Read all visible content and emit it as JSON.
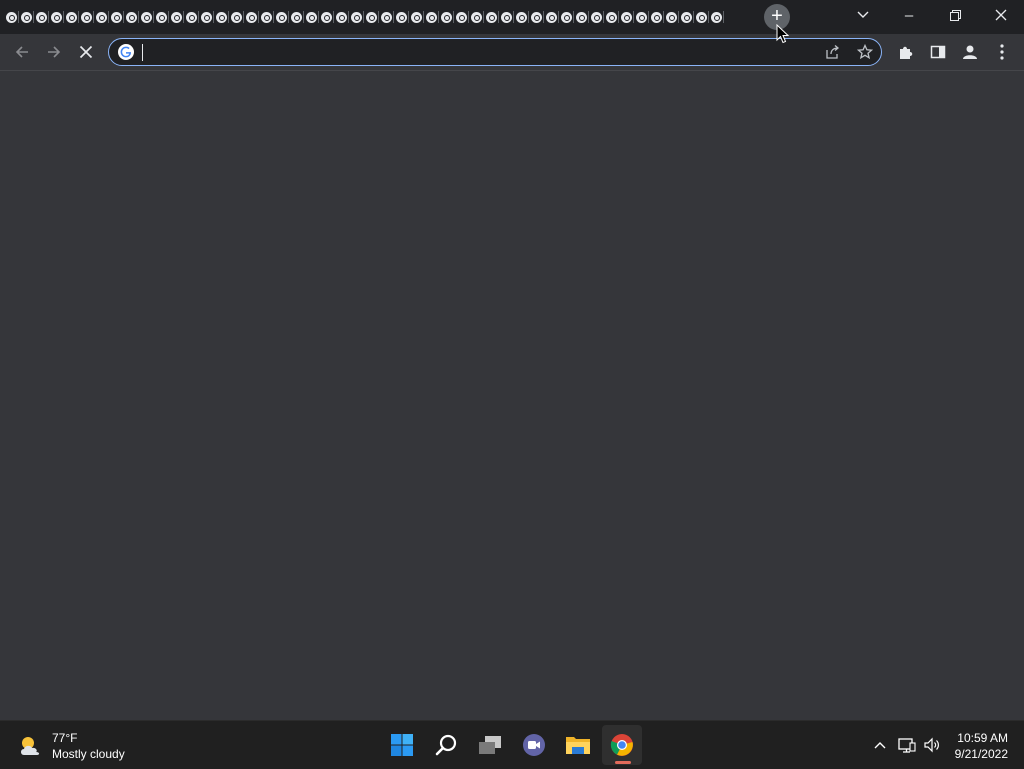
{
  "browser": {
    "tab_count": 48,
    "new_tab_label": "+",
    "window_controls": {
      "minimize": "–",
      "maximize": "❐",
      "close": "✕"
    },
    "tab_list_icon": "chevron-down-icon",
    "toolbar": {
      "back_icon": "back-arrow-icon",
      "forward_icon": "forward-arrow-icon",
      "stop_icon": "close-icon",
      "address_value": "",
      "address_placeholder": "",
      "share_icon": "share-icon",
      "bookmark_icon": "star-icon",
      "extensions_icon": "puzzle-icon",
      "side_panel_icon": "side-panel-icon",
      "profile_icon": "profile-icon",
      "menu_icon": "kebab-menu-icon"
    },
    "accent_color": "#8ab4f8"
  },
  "taskbar": {
    "weather": {
      "temperature": "77°F",
      "condition": "Mostly cloudy"
    },
    "apps": [
      "start",
      "search",
      "task-view",
      "teams-chat",
      "file-explorer",
      "chrome"
    ],
    "active_app": "chrome",
    "clock": {
      "time": "10:59 AM",
      "date": "9/21/2022"
    }
  }
}
